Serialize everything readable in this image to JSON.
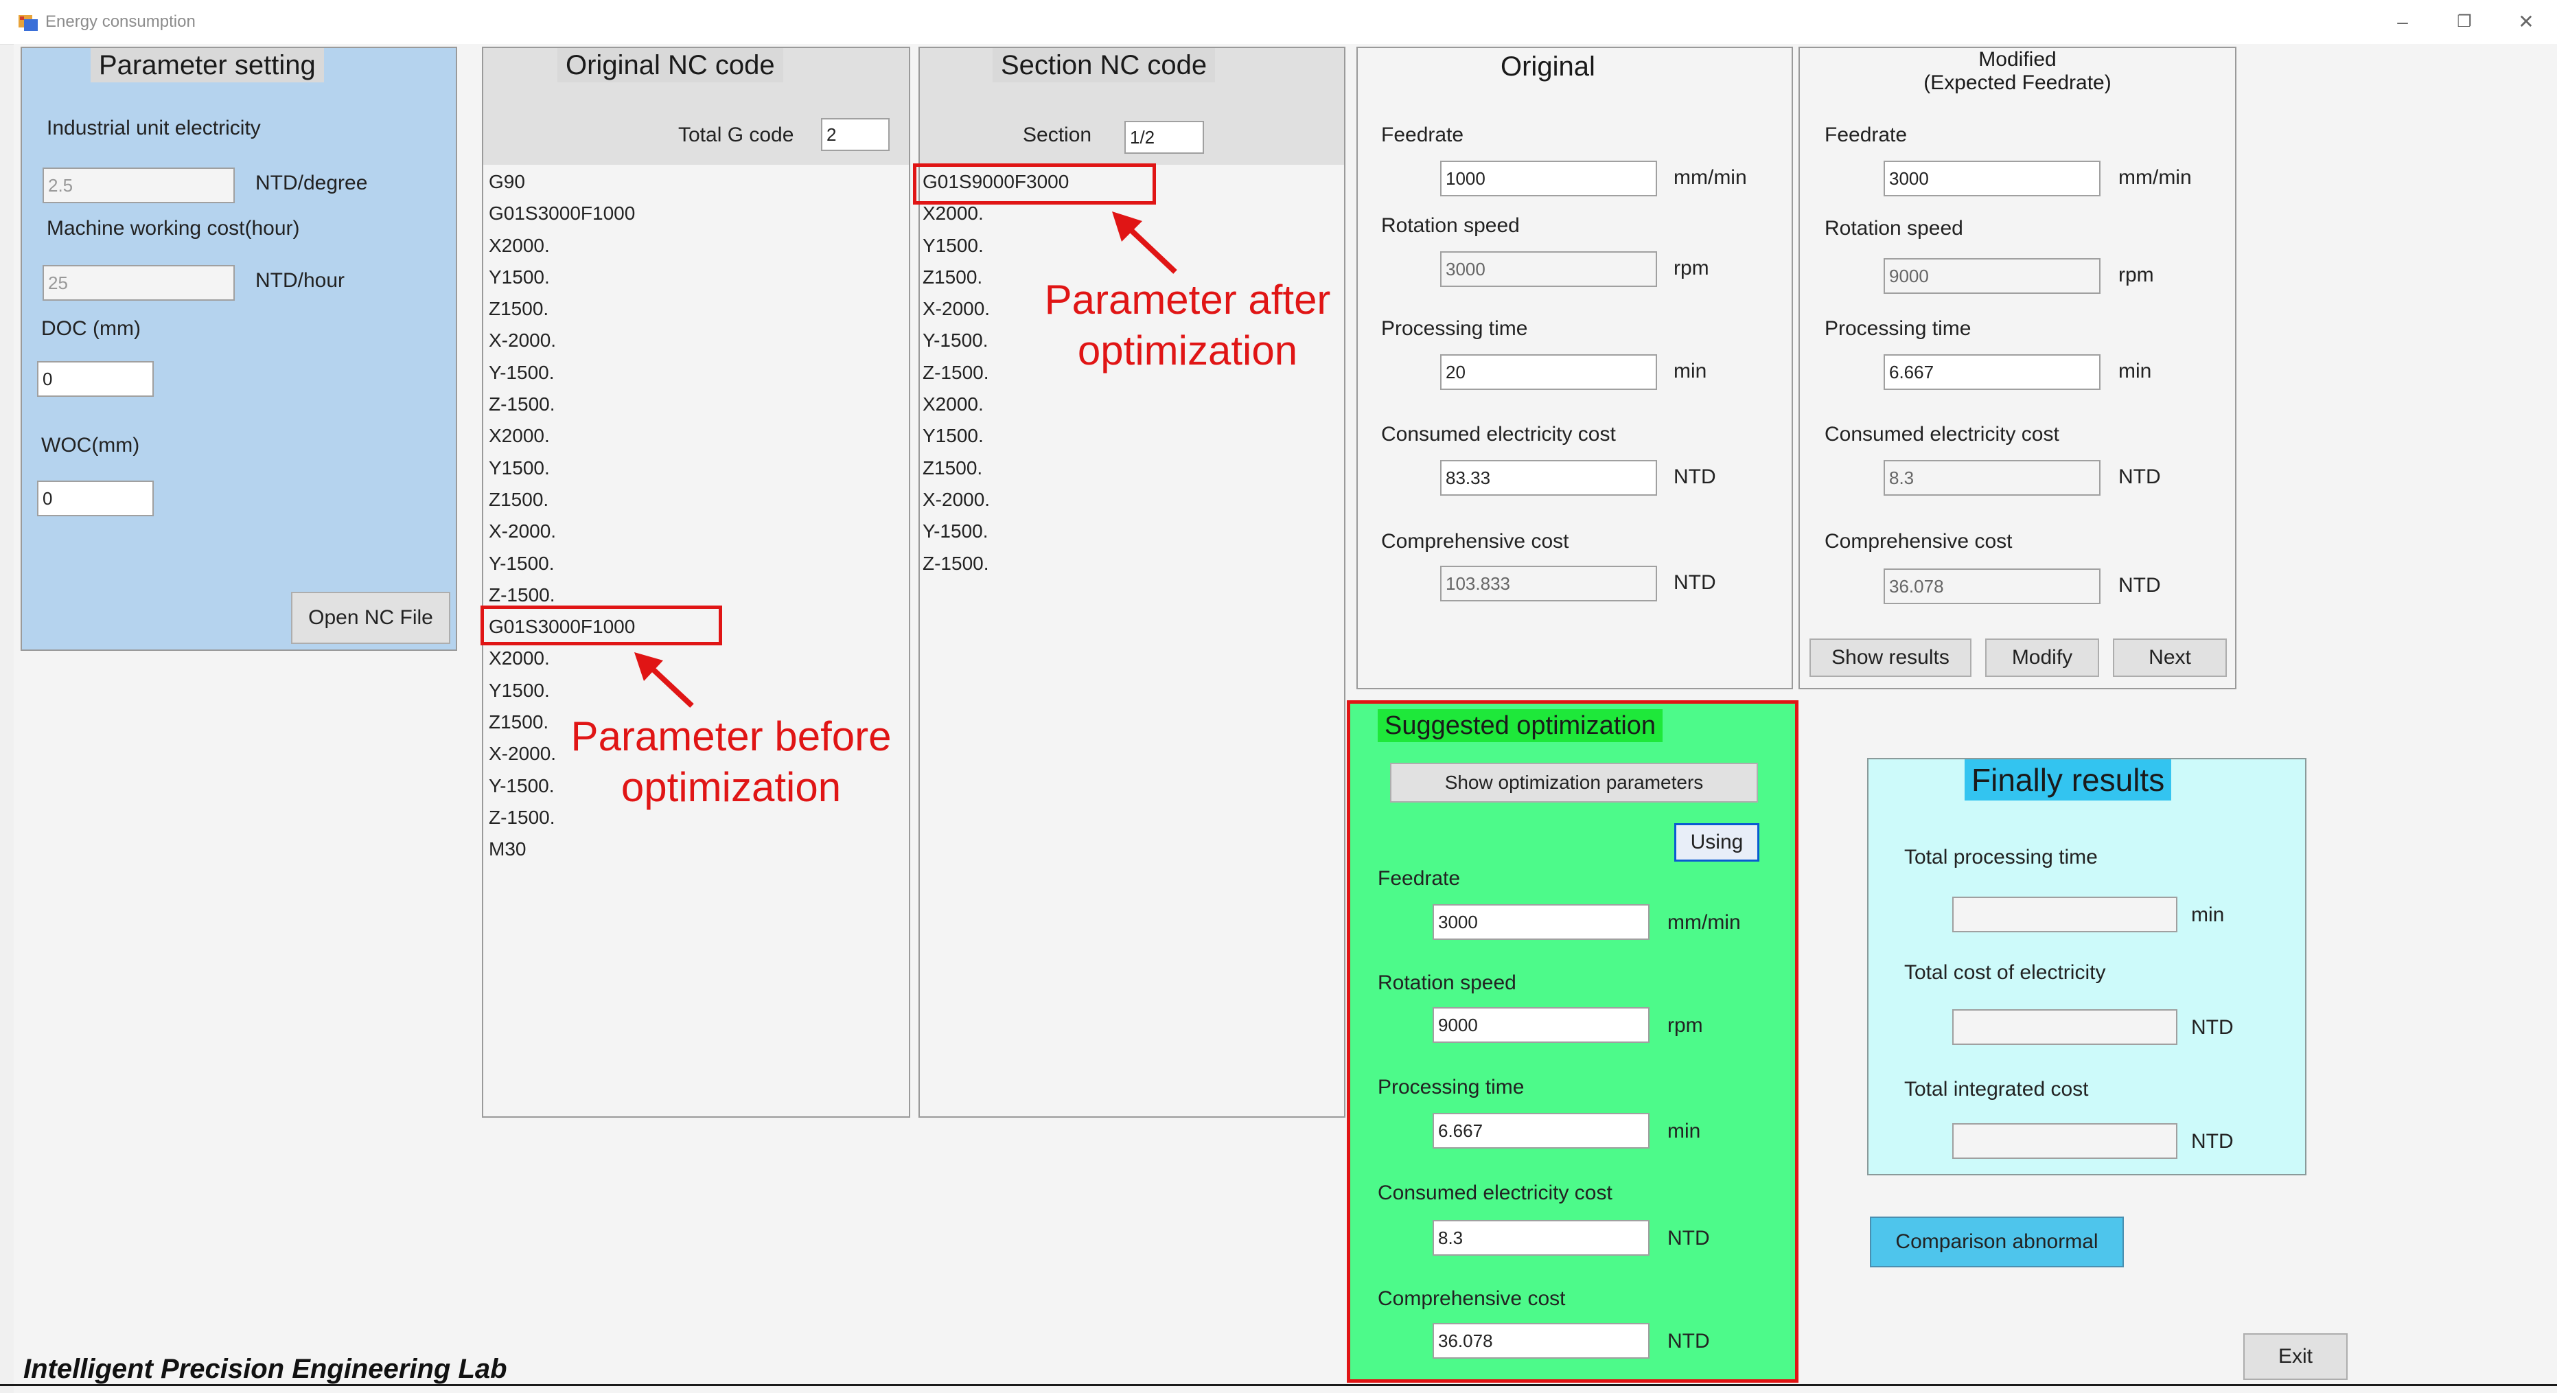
{
  "window": {
    "title": "Energy consumption",
    "minimize_glyph": "–",
    "maximize_glyph": "❐",
    "close_glyph": "✕"
  },
  "param": {
    "title": "Parameter setting",
    "electricity_label": "Industrial unit electricity",
    "electricity_value": "2.5",
    "electricity_unit": "NTD/degree",
    "machine_label": "Machine working cost(hour)",
    "machine_value": "25",
    "machine_unit": "NTD/hour",
    "doc_label": "DOC (mm)",
    "doc_value": "0",
    "woc_label": "WOC(mm)",
    "woc_value": "0",
    "open_button": "Open NC File"
  },
  "original_nc": {
    "title": "Original NC code",
    "total_label": "Total G code",
    "total_value": "2",
    "lines": [
      "G90",
      "G01S3000F1000",
      "X2000.",
      "Y1500.",
      "Z1500.",
      "X-2000.",
      "Y-1500.",
      "Z-1500.",
      "X2000.",
      "Y1500.",
      "Z1500.",
      "X-2000.",
      "Y-1500.",
      "Z-1500.",
      "G01S3000F1000",
      "X2000.",
      "Y1500.",
      "Z1500.",
      "X-2000.",
      "Y-1500.",
      "Z-1500.",
      "M30"
    ]
  },
  "section_nc": {
    "title": "Section NC code",
    "section_label": "Section",
    "section_value": "1/2",
    "lines": [
      "G01S9000F3000",
      "X2000.",
      "Y1500.",
      "Z1500.",
      "X-2000.",
      "Y-1500.",
      "Z-1500.",
      "X2000.",
      "Y1500.",
      "Z1500.",
      "X-2000.",
      "Y-1500.",
      "Z-1500."
    ]
  },
  "annotations": {
    "after_line1": "Parameter after",
    "after_line2": "optimization",
    "before_line1": "Parameter before",
    "before_line2": "optimization"
  },
  "original": {
    "title": "Original",
    "feedrate_label": "Feedrate",
    "feedrate_value": "1000",
    "feedrate_unit": "mm/min",
    "rotation_label": "Rotation speed",
    "rotation_value": "3000",
    "rotation_unit": "rpm",
    "time_label": "Processing time",
    "time_value": "20",
    "time_unit": "min",
    "elec_label": "Consumed electricity cost",
    "elec_value": "83.33",
    "elec_unit": "NTD",
    "comp_label": "Comprehensive cost",
    "comp_value": "103.833",
    "comp_unit": "NTD"
  },
  "modified": {
    "title_line1": "Modified",
    "title_line2": "(Expected Feedrate)",
    "feedrate_label": "Feedrate",
    "feedrate_value": "3000",
    "feedrate_unit": "mm/min",
    "rotation_label": "Rotation speed",
    "rotation_value": "9000",
    "rotation_unit": "rpm",
    "time_label": "Processing time",
    "time_value": "6.667",
    "time_unit": "min",
    "elec_label": "Consumed electricity cost",
    "elec_value": "8.3",
    "elec_unit": "NTD",
    "comp_label": "Comprehensive cost",
    "comp_value": "36.078",
    "comp_unit": "NTD",
    "show_button": "Show results",
    "modify_button": "Modify",
    "next_button": "Next"
  },
  "suggested": {
    "title": "Suggested optimization",
    "show_params_button": "Show optimization parameters",
    "using_button": "Using",
    "feedrate_label": "Feedrate",
    "feedrate_value": "3000",
    "feedrate_unit": "mm/min",
    "rotation_label": "Rotation speed",
    "rotation_value": "9000",
    "rotation_unit": "rpm",
    "time_label": "Processing time",
    "time_value": "6.667",
    "time_unit": "min",
    "elec_label": "Consumed electricity cost",
    "elec_value": "8.3",
    "elec_unit": "NTD",
    "comp_label": "Comprehensive cost",
    "comp_value": "36.078",
    "comp_unit": "NTD"
  },
  "final": {
    "title": "Finally results",
    "time_label": "Total processing time",
    "time_value": "",
    "time_unit": "min",
    "elec_label": "Total cost of electricity",
    "elec_value": "",
    "elec_unit": "NTD",
    "integrated_label": "Total integrated cost",
    "integrated_value": "",
    "integrated_unit": "NTD"
  },
  "comparison_button": "Comparison abnormal",
  "exit_button": "Exit",
  "footer": "Intelligent Precision Engineering Lab",
  "colors": {
    "param_bg": "#b5d3ee",
    "suggested_bg": "#4dfa8a",
    "suggested_title_bg": "#1ee83a",
    "final_bg": "#cdfafa",
    "final_title_bg": "#33c4f0",
    "comparison_bg": "#4ec5ec",
    "annotation_red": "#e01515"
  }
}
